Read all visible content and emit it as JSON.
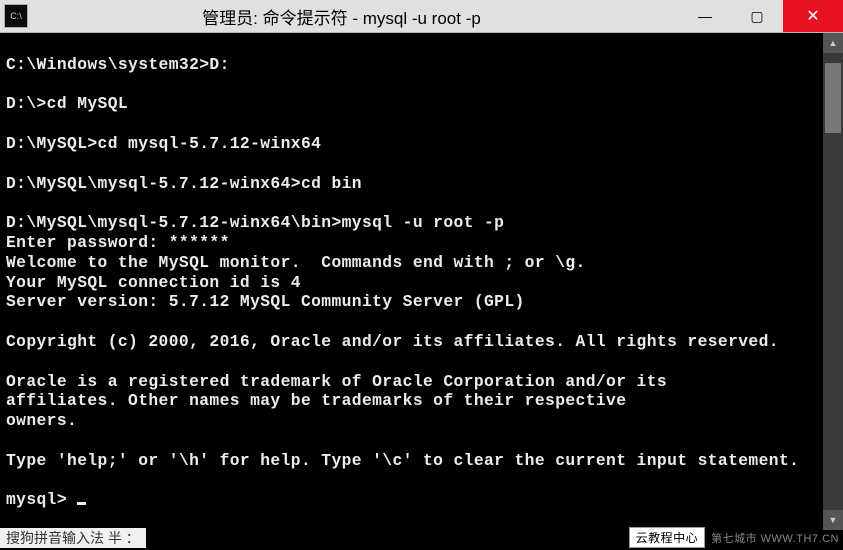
{
  "window": {
    "title": "管理员: 命令提示符 - mysql  -u root -p",
    "icon_glyph": "C:\\",
    "minimize": "—",
    "maximize": "▢",
    "close": "✕"
  },
  "terminal": {
    "lines": [
      "",
      "C:\\Windows\\system32>D:",
      "",
      "D:\\>cd MySQL",
      "",
      "D:\\MySQL>cd mysql-5.7.12-winx64",
      "",
      "D:\\MySQL\\mysql-5.7.12-winx64>cd bin",
      "",
      "D:\\MySQL\\mysql-5.7.12-winx64\\bin>mysql -u root -p",
      "Enter password: ******",
      "Welcome to the MySQL monitor.  Commands end with ; or \\g.",
      "Your MySQL connection id is 4",
      "Server version: 5.7.12 MySQL Community Server (GPL)",
      "",
      "Copyright (c) 2000, 2016, Oracle and/or its affiliates. All rights reserved.",
      "",
      "Oracle is a registered trademark of Oracle Corporation and/or its",
      "affiliates. Other names may be trademarks of their respective",
      "owners.",
      "",
      "Type 'help;' or '\\h' for help. Type '\\c' to clear the current input statement.",
      "",
      "mysql> "
    ]
  },
  "scrollbar": {
    "up": "▲",
    "down": "▼"
  },
  "ime": {
    "text": "搜狗拼音输入法 半 ："
  },
  "footer": {
    "badge": "云教程中心",
    "text": "第七城市   WWW.TH7.CN"
  }
}
